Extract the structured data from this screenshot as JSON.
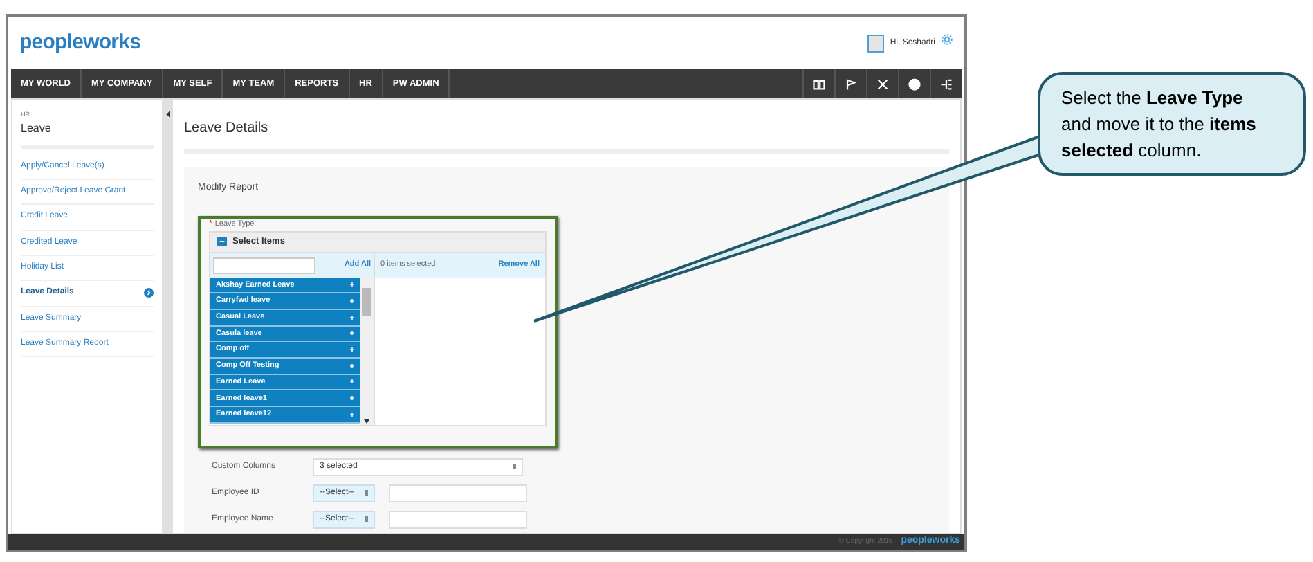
{
  "header": {
    "logo": "peopleworks",
    "user": "Hi, Seshadri"
  },
  "nav": [
    {
      "label": "MY WORLD",
      "selected": false
    },
    {
      "label": "MY COMPANY",
      "selected": false
    },
    {
      "label": "MY SELF",
      "selected": false
    },
    {
      "label": "MY TEAM",
      "selected": false
    },
    {
      "label": "REPORTS",
      "selected": false
    },
    {
      "label": "HR",
      "selected": false
    },
    {
      "label": "PW ADMIN",
      "selected": false
    }
  ],
  "sidebar": {
    "section": "HR",
    "title": "Leave",
    "items": [
      {
        "label": "Apply/Cancel Leave(s)",
        "selected": false
      },
      {
        "label": "Approve/Reject Leave Grant",
        "selected": false
      },
      {
        "label": "Credit Leave",
        "selected": false
      },
      {
        "label": "Credited Leave",
        "selected": false
      },
      {
        "label": "Holiday List",
        "selected": false
      },
      {
        "label": "Leave Details",
        "selected": true
      },
      {
        "label": "Leave Summary",
        "selected": false
      },
      {
        "label": "Leave Summary Report",
        "selected": false
      }
    ]
  },
  "content": {
    "title": "Leave Details",
    "panel_title": "Modify Report",
    "leave_type": {
      "label": "Leave Type",
      "required_mark": "*",
      "header": "Select Items",
      "add_all": "Add All",
      "selected_count": "0 items selected",
      "remove_all": "Remove All",
      "available": [
        "Akshay Earned Leave",
        "Carryfwd leave",
        "Casual Leave",
        "Casula leave",
        "Comp off",
        "Comp Off Testing",
        "Earned Leave",
        "Earned leave1",
        "Earned leave12"
      ]
    },
    "fields": [
      {
        "kind": "select",
        "label": "Custom Columns",
        "value": "3 selected"
      },
      {
        "kind": "filter",
        "label": "Employee ID",
        "operator": "--Select--"
      },
      {
        "kind": "filter",
        "label": "Employee Name",
        "operator": "--Select--"
      }
    ]
  },
  "footer": {
    "copyright": "© Copyright 2015",
    "logo": "peopleworks"
  },
  "callout": {
    "text": "Select the **Leave Type** and move it to the **items selected** column."
  }
}
